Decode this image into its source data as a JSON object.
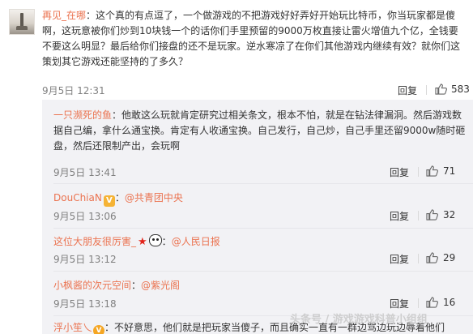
{
  "main_comment": {
    "username": "再见_在哪",
    "text": "：这个真的有点逗了，一个做游戏的不把游戏好好弄好开始玩比特币，你当玩家都是傻啊，这玩意被你们炒到10块钱一个的话你们手里预留的9000万枚直接让雷火增值九个亿，全钱要不要这么明显？最后给你们接盘的还不是玩家。逆水寒凉了在你们其他游戏内继续有效？就你们这策划其它游戏还能坚持的了多久？",
    "time": "9月5日 12:31",
    "reply_label": "回复",
    "like_count": "583"
  },
  "replies": [
    {
      "username": "一只濒死的鱼",
      "text": "：他敢这么玩就肯定研究过相关条文，根本不怕，就是在钻法律漏洞。然后游戏数据自己编，拿什么通宝换。肯定有人收通宝换。自己发行，自己炒，自己手里还留9000w随时砸盘，然后还限制产出，会玩啊",
      "time": "9月5日 13:41",
      "reply_label": "回复",
      "like_count": "71"
    },
    {
      "username": "DouChiaN",
      "mention_sep": "：",
      "mention": "@共青团中央",
      "time": "9月5日 13:06",
      "reply_label": "回复",
      "like_count": "32"
    },
    {
      "username": "这位大朋友很厉害_",
      "mention_sep": "：",
      "mention": "@人民日报",
      "time": "9月5日 13:12",
      "reply_label": "回复",
      "like_count": "29"
    },
    {
      "username": "小枫酱的次元空间",
      "mention_sep": "：",
      "mention": "@紫光阁",
      "time": "9月5日 13:18",
      "reply_label": "回复",
      "like_count": "16"
    },
    {
      "username": "浮小笙乀",
      "text": "：不好意思，他们就是把玩家当傻子，而且确实一直有一群边骂边玩边辱着他们"
    }
  ],
  "badges": {
    "vip": "V",
    "v": "V"
  },
  "watermark": "头条号 / 游戏游戏科普小组组",
  "colors": {
    "username": "#eb7350",
    "reply_bg": "#f2f2f5",
    "meta": "#808080"
  }
}
